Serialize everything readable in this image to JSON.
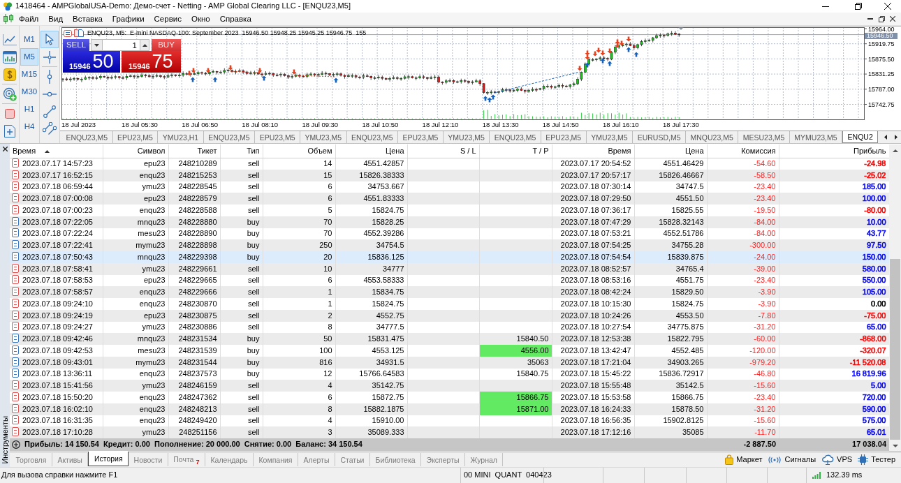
{
  "window": {
    "title": "1418464 - AMPGlobalUSA-Demo: Демо-счет - Netting - AMP Global Clearing LLC - [ENQU23,M5]"
  },
  "menu": [
    "Файл",
    "Вид",
    "Вставка",
    "Графики",
    "Сервис",
    "Окно",
    "Справка"
  ],
  "timeframes": [
    {
      "label": "M1",
      "selected": false
    },
    {
      "label": "M5",
      "selected": true
    },
    {
      "label": "M15",
      "selected": false
    },
    {
      "label": "M30",
      "selected": false
    },
    {
      "label": "H1",
      "selected": false
    },
    {
      "label": "H4",
      "selected": false
    }
  ],
  "drawing_tools": [
    {
      "kind": "cursor",
      "selected": true
    },
    {
      "kind": "crosshair",
      "selected": false
    },
    {
      "kind": "vertical_line",
      "selected": false
    },
    {
      "kind": "horizontal_line",
      "selected": false
    },
    {
      "kind": "trend_line",
      "selected": false
    },
    {
      "kind": "channel",
      "selected": false
    }
  ],
  "chart": {
    "header": "ENQU23, M5:  E-mini NASDAQ-100: September 2023  15946.50 15948.25 15945.25 15946.75  155",
    "trade_panel": {
      "sell_label": "SELL",
      "buy_label": "BUY",
      "volume": "1",
      "bid_main": "15946",
      "bid_pips": "50",
      "ask_main": "15946",
      "ask_pips": "75"
    },
    "price_labels": [
      "15964.00",
      "15919.75",
      "15875.50",
      "15831.25",
      "15787.00",
      "15742.75"
    ],
    "current_price": "15946.50",
    "time_labels": [
      "18 Jul 2023",
      "18 Jul 05:30",
      "18 Jul 06:50",
      "18 Jul 08:10",
      "18 Jul 09:30",
      "18 Jul 10:50",
      "18 Jul 12:10",
      "18 Jul 13:30",
      "18 Jul 14:50",
      "18 Jul 16:10",
      "18 Jul 17:30"
    ]
  },
  "chart_tabs": [
    {
      "label": "ENQU23,M5",
      "selected": false
    },
    {
      "label": "EPU23,M5",
      "selected": false
    },
    {
      "label": "YMU23,H1",
      "selected": false
    },
    {
      "label": "ENQU23,M5",
      "selected": false
    },
    {
      "label": "EPU23,M5",
      "selected": false
    },
    {
      "label": "YMU23,M5",
      "selected": false
    },
    {
      "label": "ENQU23,M5",
      "selected": false
    },
    {
      "label": "EPU23,M5",
      "selected": false
    },
    {
      "label": "YMU23,M5",
      "selected": false
    },
    {
      "label": "ENQU23,M5",
      "selected": false
    },
    {
      "label": "EPU23,M5",
      "selected": false
    },
    {
      "label": "YMU23,M5",
      "selected": false
    },
    {
      "label": "EURUSD,M5",
      "selected": false
    },
    {
      "label": "MNQU23,M5",
      "selected": false
    },
    {
      "label": "MESU23,M5",
      "selected": false
    },
    {
      "label": "MYMU23,M5",
      "selected": false
    },
    {
      "label": "ENQU2",
      "selected": true
    }
  ],
  "toolbox": {
    "side_label": "Инструменты",
    "table": {
      "columns": [
        {
          "label": "Время",
          "sorted": true
        },
        {
          "label": "Символ",
          "sorted": false
        },
        {
          "label": "Тикет",
          "sorted": false
        },
        {
          "label": "Тип",
          "sorted": false
        },
        {
          "label": "Объем",
          "sorted": false
        },
        {
          "label": "Цена",
          "sorted": false
        },
        {
          "label": "S / L",
          "sorted": false
        },
        {
          "label": "T / P",
          "sorted": false
        },
        {
          "label": "Время",
          "sorted": false
        },
        {
          "label": "Цена",
          "sorted": false
        },
        {
          "label": "Комиссия",
          "sorted": false
        },
        {
          "label": "Прибыль",
          "sorted": false
        }
      ],
      "rows": [
        {
          "kind": "sell",
          "time": "2023.07.17 14:57:23",
          "symbol": "epu23",
          "ticket": "248210289",
          "type": "sell",
          "volume": "14",
          "price": "4551.42857",
          "close_time": "2023.07.17 20:54:52",
          "close_price": "4551.46429",
          "commission": "-54.60",
          "profit": {
            "text": "-24.98",
            "color": "#ff0000"
          },
          "selected": false
        },
        {
          "kind": "sell",
          "time": "2023.07.17 16:52:15",
          "symbol": "enqu23",
          "ticket": "248215253",
          "type": "sell",
          "volume": "15",
          "price": "15826.38333",
          "close_time": "2023.07.17 20:57:17",
          "close_price": "15826.46667",
          "commission": "-58.50",
          "profit": {
            "text": "-25.02",
            "color": "#ff0000"
          },
          "selected": false
        },
        {
          "kind": "sell",
          "time": "2023.07.18 06:59:44",
          "symbol": "ymu23",
          "ticket": "248228545",
          "type": "sell",
          "volume": "6",
          "price": "34753.667",
          "close_time": "2023.07.18 07:30:14",
          "close_price": "34747.5",
          "commission": "-23.40",
          "profit": {
            "text": "185.00",
            "color": "#0000ff"
          },
          "selected": false
        },
        {
          "kind": "sell",
          "time": "2023.07.18 07:00:08",
          "symbol": "epu23",
          "ticket": "248228579",
          "type": "sell",
          "volume": "6",
          "price": "4551.83333",
          "close_time": "2023.07.18 07:29:50",
          "close_price": "4551.50",
          "commission": "-23.40",
          "profit": {
            "text": "100.00",
            "color": "#0000ff"
          },
          "selected": false
        },
        {
          "kind": "sell",
          "time": "2023.07.18 07:00:23",
          "symbol": "enqu23",
          "ticket": "248228588",
          "type": "sell",
          "volume": "5",
          "price": "15824.75",
          "close_time": "2023.07.18 07:36:17",
          "close_price": "15825.55",
          "commission": "-19.50",
          "profit": {
            "text": "-80.00",
            "color": "#ff0000"
          },
          "selected": false
        },
        {
          "kind": "buy",
          "time": "2023.07.18 07:22:05",
          "symbol": "mnqu23",
          "ticket": "248228880",
          "type": "buy",
          "volume": "70",
          "price": "15828.25",
          "close_time": "2023.07.18 07:47:29",
          "close_price": "15828.32143",
          "commission": "-84.00",
          "profit": {
            "text": "10.00",
            "color": "#0000ff"
          },
          "selected": false
        },
        {
          "kind": "buy",
          "time": "2023.07.18 07:22:24",
          "symbol": "mesu23",
          "ticket": "248228890",
          "type": "buy",
          "volume": "70",
          "price": "4552.39286",
          "close_time": "2023.07.18 07:53:21",
          "close_price": "4552.51786",
          "commission": "-84.00",
          "profit": {
            "text": "43.77",
            "color": "#0000ff"
          },
          "selected": false
        },
        {
          "kind": "buy",
          "time": "2023.07.18 07:22:41",
          "symbol": "mymu23",
          "ticket": "248228898",
          "type": "buy",
          "volume": "250",
          "price": "34754.5",
          "close_time": "2023.07.18 07:54:25",
          "close_price": "34755.28",
          "commission": "-300.00",
          "profit": {
            "text": "97.50",
            "color": "#0000ff"
          },
          "selected": false
        },
        {
          "kind": "buy",
          "time": "2023.07.18 07:50:43",
          "symbol": "mnqu23",
          "ticket": "248229398",
          "type": "buy",
          "volume": "20",
          "price": "15836.125",
          "close_time": "2023.07.18 07:54:54",
          "close_price": "15839.875",
          "commission": "-24.00",
          "profit": {
            "text": "150.00",
            "color": "#0000ff"
          },
          "selected": true
        },
        {
          "kind": "sell",
          "time": "2023.07.18 07:58:41",
          "symbol": "ymu23",
          "ticket": "248229661",
          "type": "sell",
          "volume": "10",
          "price": "34777",
          "close_time": "2023.07.18 08:52:57",
          "close_price": "34765.4",
          "commission": "-39.00",
          "profit": {
            "text": "580.00",
            "color": "#0000ff"
          },
          "selected": false
        },
        {
          "kind": "sell",
          "time": "2023.07.18 07:58:53",
          "symbol": "epu23",
          "ticket": "248229665",
          "type": "sell",
          "volume": "6",
          "price": "4553.58333",
          "close_time": "2023.07.18 08:53:16",
          "close_price": "4551.75",
          "commission": "-23.40",
          "profit": {
            "text": "550.00",
            "color": "#0000ff"
          },
          "selected": false
        },
        {
          "kind": "sell",
          "time": "2023.07.18 07:58:57",
          "symbol": "enqu23",
          "ticket": "248229666",
          "type": "sell",
          "volume": "1",
          "price": "15834.75",
          "close_time": "2023.07.18 08:42:24",
          "close_price": "15829.50",
          "commission": "-3.90",
          "profit": {
            "text": "105.00",
            "color": "#0000ff"
          },
          "selected": false
        },
        {
          "kind": "sell",
          "time": "2023.07.18 09:24:10",
          "symbol": "enqu23",
          "ticket": "248230870",
          "type": "sell",
          "volume": "1",
          "price": "15824.75",
          "close_time": "2023.07.18 10:15:30",
          "close_price": "15824.75",
          "commission": "-3.90",
          "profit": {
            "text": "0.00",
            "color": "#000000"
          },
          "selected": false
        },
        {
          "kind": "sell",
          "time": "2023.07.18 09:24:19",
          "symbol": "epu23",
          "ticket": "248230875",
          "type": "sell",
          "volume": "2",
          "price": "4552.75",
          "close_time": "2023.07.18 10:24:26",
          "close_price": "4553.50",
          "commission": "-7.80",
          "profit": {
            "text": "-75.00",
            "color": "#ff0000"
          },
          "selected": false
        },
        {
          "kind": "sell",
          "time": "2023.07.18 09:24:27",
          "symbol": "ymu23",
          "ticket": "248230886",
          "type": "sell",
          "volume": "8",
          "price": "34777.5",
          "close_time": "2023.07.18 10:27:54",
          "close_price": "34775.875",
          "commission": "-31.20",
          "profit": {
            "text": "65.00",
            "color": "#0000ff"
          },
          "selected": false
        },
        {
          "kind": "buy",
          "time": "2023.07.18 09:42:46",
          "symbol": "mnqu23",
          "ticket": "248231534",
          "type": "buy",
          "volume": "50",
          "price": "15831.475",
          "tp": {
            "text": "15840.50",
            "hit": false
          },
          "close_time": "2023.07.18 12:53:38",
          "close_price": "15822.795",
          "commission": "-60.00",
          "profit": {
            "text": "-868.00",
            "color": "#ff0000"
          },
          "selected": false
        },
        {
          "kind": "buy",
          "time": "2023.07.18 09:42:53",
          "symbol": "mesu23",
          "ticket": "248231539",
          "type": "buy",
          "volume": "100",
          "price": "4553.125",
          "tp": {
            "text": "4556.00",
            "hit": true
          },
          "close_time": "2023.07.18 13:42:47",
          "close_price": "4552.485",
          "commission": "-120.00",
          "profit": {
            "text": "-320.07",
            "color": "#ff0000"
          },
          "selected": false
        },
        {
          "kind": "buy",
          "time": "2023.07.18 09:43:01",
          "symbol": "mymu23",
          "ticket": "248231544",
          "type": "buy",
          "volume": "816",
          "price": "34931.5",
          "tp": {
            "text": "35063",
            "hit": false
          },
          "close_time": "2023.07.18 17:21:04",
          "close_price": "34903.265",
          "commission": "-979.20",
          "profit": {
            "text": "-11 520.08",
            "color": "#ff0000"
          },
          "selected": false
        },
        {
          "kind": "buy",
          "time": "2023.07.18 13:36:11",
          "symbol": "enqu23",
          "ticket": "248237573",
          "type": "buy",
          "volume": "12",
          "price": "15766.64583",
          "tp": {
            "text": "15840.75",
            "hit": false
          },
          "close_time": "2023.07.18 15:45:22",
          "close_price": "15836.72917",
          "commission": "-46.80",
          "profit": {
            "text": "16 819.96",
            "color": "#0000ff"
          },
          "selected": false
        },
        {
          "kind": "sell",
          "time": "2023.07.18 15:41:56",
          "symbol": "ymu23",
          "ticket": "248246159",
          "type": "sell",
          "volume": "4",
          "price": "35142.75",
          "close_time": "2023.07.18 15:55:48",
          "close_price": "35142.5",
          "commission": "-15.60",
          "profit": {
            "text": "5.00",
            "color": "#0000ff"
          },
          "selected": false
        },
        {
          "kind": "sell",
          "time": "2023.07.18 15:50:20",
          "symbol": "enqu23",
          "ticket": "248247362",
          "type": "sell",
          "volume": "6",
          "price": "15872.75",
          "tp": {
            "text": "15866.75",
            "hit": true
          },
          "close_time": "2023.07.18 15:53:58",
          "close_price": "15866.75",
          "commission": "-23.40",
          "profit": {
            "text": "720.00",
            "color": "#0000ff"
          },
          "selected": false
        },
        {
          "kind": "sell",
          "time": "2023.07.18 16:02:10",
          "symbol": "enqu23",
          "ticket": "248248213",
          "type": "sell",
          "volume": "8",
          "price": "15882.1875",
          "tp": {
            "text": "15871.00",
            "hit": true
          },
          "close_time": "2023.07.18 16:24:33",
          "close_price": "15878.50",
          "commission": "-31.20",
          "profit": {
            "text": "590.00",
            "color": "#0000ff"
          },
          "selected": false
        },
        {
          "kind": "sell",
          "time": "2023.07.18 16:31:35",
          "symbol": "enqu23",
          "ticket": "248249420",
          "type": "sell",
          "volume": "4",
          "price": "15910.00",
          "close_time": "2023.07.18 16:56:35",
          "close_price": "15902.8125",
          "commission": "-15.60",
          "profit": {
            "text": "575.00",
            "color": "#0000ff"
          },
          "selected": false
        },
        {
          "kind": "sell",
          "time": "2023.07.18 17:10:28",
          "symbol": "ymu23",
          "ticket": "248251156",
          "type": "sell",
          "volume": "3",
          "price": "35089.333",
          "close_time": "2023.07.18 17:12:16",
          "close_price": "35085",
          "commission": "-11.70",
          "profit": {
            "text": "65.01",
            "color": "#0000ff"
          },
          "selected": false
        }
      ],
      "summary": "Прибыль: 14 150.54  Кредит: 0.00  Пополнение: 20 000.00  Снятие: 0.00  Баланс: 34 150.54",
      "total_commission": "-2 887.50",
      "total_profit": "17 038.04"
    },
    "tabs": [
      {
        "label": "Торговля",
        "selected": false
      },
      {
        "label": "Активы",
        "selected": false
      },
      {
        "label": "История",
        "selected": true
      },
      {
        "label": "Новости",
        "selected": false
      },
      {
        "label": "Почта",
        "badge": "7",
        "selected": false
      },
      {
        "label": "Календарь",
        "selected": false
      },
      {
        "label": "Компания",
        "selected": false
      },
      {
        "label": "Алерты",
        "selected": false
      },
      {
        "label": "Статьи",
        "selected": false
      },
      {
        "label": "Библиотека",
        "selected": false
      },
      {
        "label": "Эксперты",
        "selected": false
      },
      {
        "label": "Журнал",
        "selected": false
      }
    ],
    "services": [
      {
        "kind": "market",
        "label": "Маркет"
      },
      {
        "kind": "signals",
        "label": "Сигналы"
      },
      {
        "kind": "vps",
        "label": "VPS"
      },
      {
        "kind": "tester",
        "label": "Тестер"
      }
    ]
  },
  "status_bar": {
    "help": "Для вызова справки нажмите F1",
    "account": "00 MINI  QUANT  040423",
    "ping": "132.39 ms"
  }
}
